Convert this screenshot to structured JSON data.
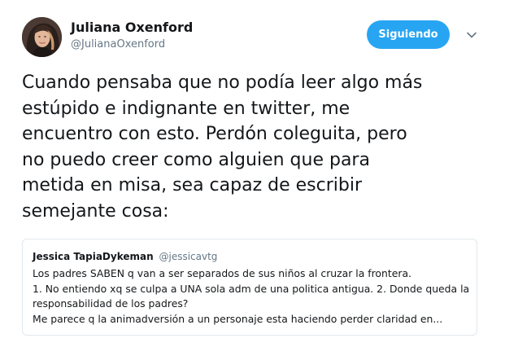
{
  "colors": {
    "accent": "#1da1f2",
    "text_primary": "#14171a",
    "text_secondary": "#657786",
    "border": "#e1e8ed"
  },
  "author": {
    "display_name": "Juliana Oxenford",
    "handle": "@JulianaOxenford",
    "avatar_icon": "profile-photo"
  },
  "follow_button": {
    "label": "Siguiendo"
  },
  "menu": {
    "icon": "chevron-down-icon"
  },
  "tweet": {
    "lines": [
      "Cuando pensaba que no podía leer algo más",
      "estúpido e indignante en twitter, me",
      "encuentro con esto. Perdón coleguita, pero",
      "no puedo creer como alguien que para",
      "metida en misa, sea capaz de escribir",
      "semejante cosa:"
    ]
  },
  "quoted_tweet": {
    "display_name": "Jessica TapiaDykeman",
    "handle": "@jessicavtg",
    "lines": [
      "Los padres SABEN q van a ser separados de sus niños al cruzar la frontera.",
      "1. No entiendo xq se culpa a UNA sola adm de una politica antigua. 2. Donde queda la",
      "responsabilidad de los padres?",
      "Me parece q la animadversión a un personaje esta haciendo perder claridad en..."
    ]
  }
}
